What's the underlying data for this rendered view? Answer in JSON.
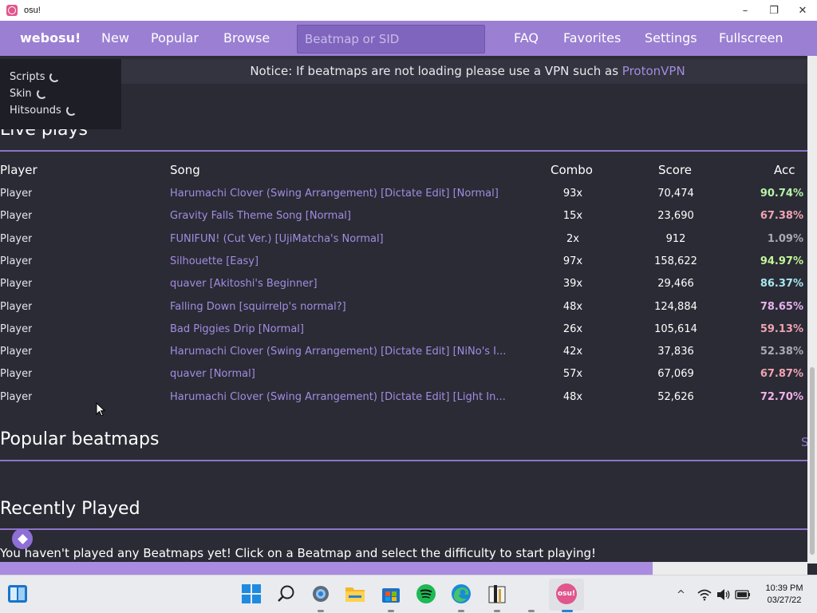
{
  "window": {
    "title": "osu!"
  },
  "nav": {
    "brand": "webosu!",
    "items": [
      "New",
      "Popular",
      "Browse"
    ],
    "search_placeholder": "Beatmap or SID",
    "right_items": [
      "FAQ",
      "Favorites",
      "Settings",
      "Fullscreen"
    ]
  },
  "notice": {
    "text": "Notice: If beatmaps are not loading please use a VPN such as ",
    "link": "ProtonVPN"
  },
  "loading": [
    "Scripts",
    "Skin",
    "Hitsounds"
  ],
  "live_plays": {
    "title": "Live plays",
    "columns": [
      "Player",
      "Song",
      "Combo",
      "Score",
      "Acc"
    ],
    "rows": [
      {
        "player": "Player",
        "song": "Harumachi Clover (Swing Arrangement) [Dictate Edit] [Normal]",
        "combo": "93x",
        "score": "70,474",
        "acc": "90.74%",
        "acc_color": "#b6f3a6"
      },
      {
        "player": "Player",
        "song": "Gravity Falls Theme Song [Normal]",
        "combo": "15x",
        "score": "23,690",
        "acc": "67.38%",
        "acc_color": "#f0a3b0"
      },
      {
        "player": "Player",
        "song": "FUNIFUN! (Cut Ver.) [UjiMatcha's Normal]",
        "combo": "2x",
        "score": "912",
        "acc": "1.09%",
        "acc_color": "#a9a9b4"
      },
      {
        "player": "Player",
        "song": "Silhouette [Easy]",
        "combo": "97x",
        "score": "158,622",
        "acc": "94.97%",
        "acc_color": "#c4f59a"
      },
      {
        "player": "Player",
        "song": "quaver [Akitoshi's Beginner]",
        "combo": "39x",
        "score": "29,466",
        "acc": "86.37%",
        "acc_color": "#a8e6f0"
      },
      {
        "player": "Player",
        "song": "Falling Down [squirrelp's normal?]",
        "combo": "48x",
        "score": "124,884",
        "acc": "78.65%",
        "acc_color": "#e8b0ee"
      },
      {
        "player": "Player",
        "song": "Bad Piggies Drip [Normal]",
        "combo": "26x",
        "score": "105,614",
        "acc": "59.13%",
        "acc_color": "#f0a3b0"
      },
      {
        "player": "Player",
        "song": "Harumachi Clover (Swing Arrangement) [Dictate Edit] [NiNo's I...",
        "combo": "42x",
        "score": "37,836",
        "acc": "52.38%",
        "acc_color": "#a9a9b4"
      },
      {
        "player": "Player",
        "song": "quaver [Normal]",
        "combo": "57x",
        "score": "67,069",
        "acc": "67.87%",
        "acc_color": "#f0a3b0"
      },
      {
        "player": "Player",
        "song": "Harumachi Clover (Swing Arrangement) [Dictate Edit] [Light In...",
        "combo": "48x",
        "score": "52,626",
        "acc": "72.70%",
        "acc_color": "#f2b0e8"
      }
    ]
  },
  "popular": {
    "title": "Popular beatmaps",
    "partial_link": "S"
  },
  "recent": {
    "title": "Recently Played",
    "message": "You haven't played any Beatmaps yet! Click on a Beatmap and select the difficulty to start playing!"
  },
  "taskbar": {
    "time": "10:39 PM",
    "date": "03/27/22",
    "tray_chevron": "^"
  }
}
